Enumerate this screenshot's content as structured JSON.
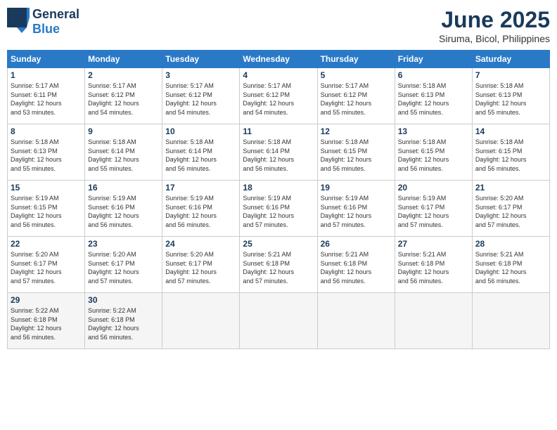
{
  "header": {
    "logo_general": "General",
    "logo_blue": "Blue",
    "month_title": "June 2025",
    "subtitle": "Siruma, Bicol, Philippines"
  },
  "calendar": {
    "days_of_week": [
      "Sunday",
      "Monday",
      "Tuesday",
      "Wednesday",
      "Thursday",
      "Friday",
      "Saturday"
    ],
    "weeks": [
      [
        {
          "day": 1,
          "sunrise": "5:17 AM",
          "sunset": "6:11 PM",
          "daylight": "12 hours and 53 minutes."
        },
        {
          "day": 2,
          "sunrise": "5:17 AM",
          "sunset": "6:12 PM",
          "daylight": "12 hours and 54 minutes."
        },
        {
          "day": 3,
          "sunrise": "5:17 AM",
          "sunset": "6:12 PM",
          "daylight": "12 hours and 54 minutes."
        },
        {
          "day": 4,
          "sunrise": "5:17 AM",
          "sunset": "6:12 PM",
          "daylight": "12 hours and 54 minutes."
        },
        {
          "day": 5,
          "sunrise": "5:17 AM",
          "sunset": "6:12 PM",
          "daylight": "12 hours and 55 minutes."
        },
        {
          "day": 6,
          "sunrise": "5:18 AM",
          "sunset": "6:13 PM",
          "daylight": "12 hours and 55 minutes."
        },
        {
          "day": 7,
          "sunrise": "5:18 AM",
          "sunset": "6:13 PM",
          "daylight": "12 hours and 55 minutes."
        }
      ],
      [
        {
          "day": 8,
          "sunrise": "5:18 AM",
          "sunset": "6:13 PM",
          "daylight": "12 hours and 55 minutes."
        },
        {
          "day": 9,
          "sunrise": "5:18 AM",
          "sunset": "6:14 PM",
          "daylight": "12 hours and 55 minutes."
        },
        {
          "day": 10,
          "sunrise": "5:18 AM",
          "sunset": "6:14 PM",
          "daylight": "12 hours and 56 minutes."
        },
        {
          "day": 11,
          "sunrise": "5:18 AM",
          "sunset": "6:14 PM",
          "daylight": "12 hours and 56 minutes."
        },
        {
          "day": 12,
          "sunrise": "5:18 AM",
          "sunset": "6:15 PM",
          "daylight": "12 hours and 56 minutes."
        },
        {
          "day": 13,
          "sunrise": "5:18 AM",
          "sunset": "6:15 PM",
          "daylight": "12 hours and 56 minutes."
        },
        {
          "day": 14,
          "sunrise": "5:18 AM",
          "sunset": "6:15 PM",
          "daylight": "12 hours and 56 minutes."
        }
      ],
      [
        {
          "day": 15,
          "sunrise": "5:19 AM",
          "sunset": "6:15 PM",
          "daylight": "12 hours and 56 minutes."
        },
        {
          "day": 16,
          "sunrise": "5:19 AM",
          "sunset": "6:16 PM",
          "daylight": "12 hours and 56 minutes."
        },
        {
          "day": 17,
          "sunrise": "5:19 AM",
          "sunset": "6:16 PM",
          "daylight": "12 hours and 56 minutes."
        },
        {
          "day": 18,
          "sunrise": "5:19 AM",
          "sunset": "6:16 PM",
          "daylight": "12 hours and 57 minutes."
        },
        {
          "day": 19,
          "sunrise": "5:19 AM",
          "sunset": "6:16 PM",
          "daylight": "12 hours and 57 minutes."
        },
        {
          "day": 20,
          "sunrise": "5:19 AM",
          "sunset": "6:17 PM",
          "daylight": "12 hours and 57 minutes."
        },
        {
          "day": 21,
          "sunrise": "5:20 AM",
          "sunset": "6:17 PM",
          "daylight": "12 hours and 57 minutes."
        }
      ],
      [
        {
          "day": 22,
          "sunrise": "5:20 AM",
          "sunset": "6:17 PM",
          "daylight": "12 hours and 57 minutes."
        },
        {
          "day": 23,
          "sunrise": "5:20 AM",
          "sunset": "6:17 PM",
          "daylight": "12 hours and 57 minutes."
        },
        {
          "day": 24,
          "sunrise": "5:20 AM",
          "sunset": "6:17 PM",
          "daylight": "12 hours and 57 minutes."
        },
        {
          "day": 25,
          "sunrise": "5:21 AM",
          "sunset": "6:18 PM",
          "daylight": "12 hours and 57 minutes."
        },
        {
          "day": 26,
          "sunrise": "5:21 AM",
          "sunset": "6:18 PM",
          "daylight": "12 hours and 56 minutes."
        },
        {
          "day": 27,
          "sunrise": "5:21 AM",
          "sunset": "6:18 PM",
          "daylight": "12 hours and 56 minutes."
        },
        {
          "day": 28,
          "sunrise": "5:21 AM",
          "sunset": "6:18 PM",
          "daylight": "12 hours and 56 minutes."
        }
      ],
      [
        {
          "day": 29,
          "sunrise": "5:22 AM",
          "sunset": "6:18 PM",
          "daylight": "12 hours and 56 minutes."
        },
        {
          "day": 30,
          "sunrise": "5:22 AM",
          "sunset": "6:18 PM",
          "daylight": "12 hours and 56 minutes."
        },
        null,
        null,
        null,
        null,
        null
      ]
    ]
  }
}
